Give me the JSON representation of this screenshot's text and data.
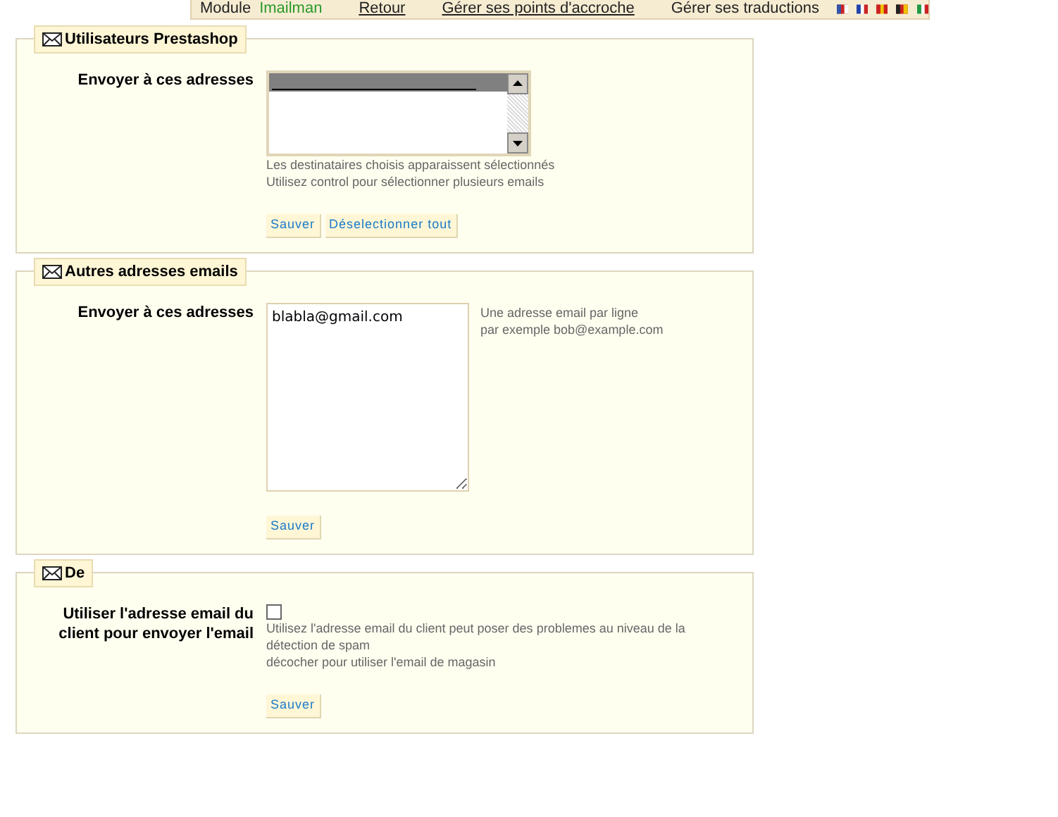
{
  "top_bar": {
    "module_label": "Module",
    "module_name": "Imailman",
    "links": [
      "Retour",
      "Gérer ses points d'accroche"
    ],
    "translations_label": "Gérer ses traductions"
  },
  "sections": [
    {
      "kind": "select",
      "title": "Utilisateurs Prestashop",
      "label": "Envoyer à ces adresses",
      "list_items": [
        {
          "selected": true
        }
      ],
      "hints": [
        "Les destinataires choisis apparaissent sélectionnés",
        "Utilisez control pour sélectionner plusieurs emails"
      ],
      "buttons": [
        "Sauver",
        "Déselectionner tout"
      ]
    },
    {
      "kind": "textarea",
      "title": "Autres adresses emails",
      "label": "Envoyer à ces adresses",
      "value": "blabla@gmail.com",
      "hints": [
        "Une adresse email par ligne",
        "par exemple bob@example.com"
      ],
      "buttons": [
        "Sauver"
      ]
    },
    {
      "kind": "checkbox",
      "title": "De",
      "label": "Utiliser l'adresse email du client pour envoyer l'email",
      "checked": false,
      "hints": [
        "Utilisez l'adresse email du client peut poser des problemes au niveau de la détection de spam",
        "décocher pour utiliser l'email de magasin"
      ],
      "buttons": [
        "Sauver"
      ]
    }
  ]
}
